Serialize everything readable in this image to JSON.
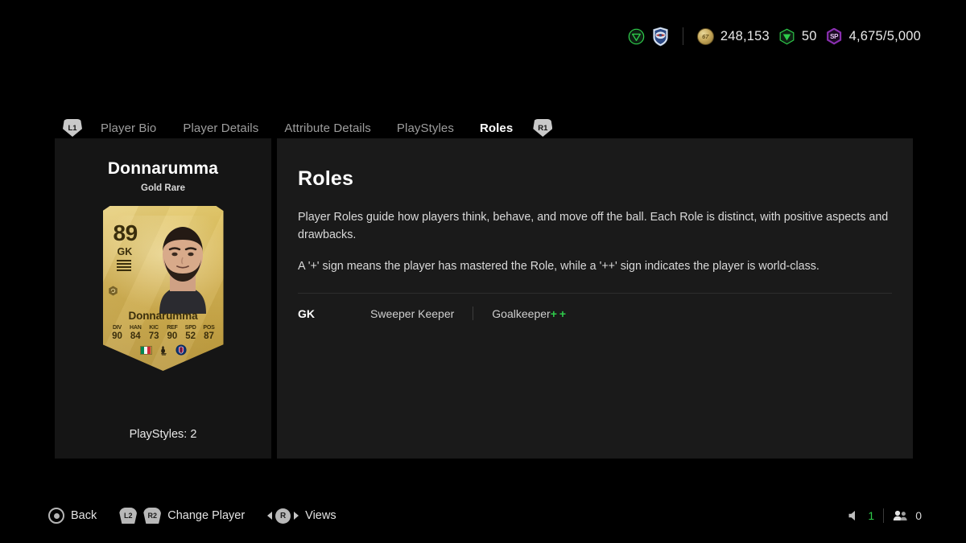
{
  "hud": {
    "club_icons": [
      "volta-triangle-icon",
      "club-crest-icon"
    ],
    "coins": {
      "icon": "coins-icon",
      "icon_text": "67",
      "value": "248,153"
    },
    "points": {
      "icon": "fc-points-icon",
      "value": "50"
    },
    "sp": {
      "icon": "sp-hexagon-icon",
      "icon_text": "SP",
      "value": "4,675/5,000"
    }
  },
  "tabs": {
    "left_bumper": "L1",
    "right_bumper": "R1",
    "items": [
      {
        "label": "Player Bio",
        "active": false
      },
      {
        "label": "Player Details",
        "active": false
      },
      {
        "label": "Attribute Details",
        "active": false
      },
      {
        "label": "PlayStyles",
        "active": false
      },
      {
        "label": "Roles",
        "active": true
      }
    ]
  },
  "player": {
    "name": "Donnarumma",
    "rarity": "Gold Rare",
    "playstyles_label": "PlayStyles: 2",
    "card": {
      "rating": "89",
      "position": "GK",
      "name": "Donnarumma",
      "stats": [
        {
          "label": "DIV",
          "value": "90"
        },
        {
          "label": "HAN",
          "value": "84"
        },
        {
          "label": "KIC",
          "value": "73"
        },
        {
          "label": "REF",
          "value": "90"
        },
        {
          "label": "SPD",
          "value": "52"
        },
        {
          "label": "POS",
          "value": "87"
        }
      ],
      "nation": "italy-flag-icon",
      "league": "ligue1-logo-icon",
      "club": "psg-crest-icon"
    }
  },
  "roles": {
    "title": "Roles",
    "description_1": "Player Roles guide how players think, behave, and move off the ball. Each Role is distinct, with positive aspects and drawbacks.",
    "description_2": "A '+' sign means the player has mastered the Role, while a '++' sign indicates the player is world-class.",
    "rows": [
      {
        "position": "GK",
        "role_a": "Sweeper Keeper",
        "role_b": "Goalkeeper",
        "role_b_plus_1": "+",
        "role_b_plus_2": "+"
      }
    ]
  },
  "bottom_bar": {
    "back": {
      "icon": "circle-button-icon",
      "label": "Back"
    },
    "change_player": {
      "trigger_left": "L2",
      "trigger_right": "R2",
      "label": "Change Player"
    },
    "views": {
      "stick": "R",
      "label": "Views"
    },
    "audio": {
      "icon": "speaker-icon",
      "value": "1"
    },
    "players_online": {
      "icon": "people-icon",
      "value": "0"
    }
  },
  "colors": {
    "accent_green": "#2ecc4a",
    "card_gold": "#d3b254",
    "sp_purple": "#8a2fb0"
  }
}
